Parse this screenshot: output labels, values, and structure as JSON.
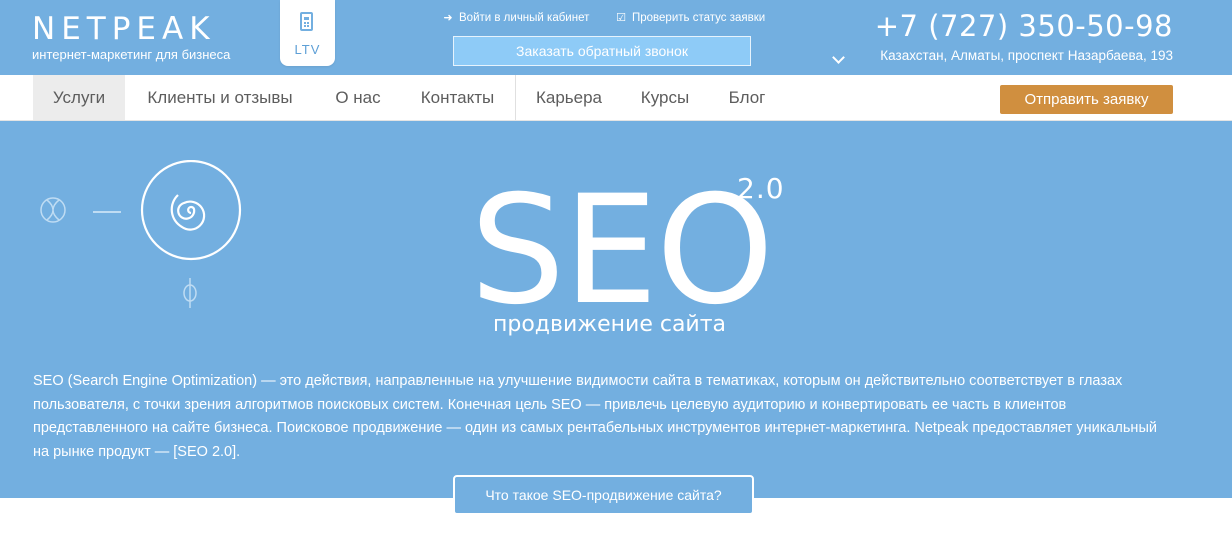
{
  "header": {
    "logo": "NETPEAK",
    "tagline": "интернет-маркетинг для бизнеса",
    "ltv_label": "LTV",
    "account_link": "Войти в личный кабинет",
    "status_link": "Проверить статус заявки",
    "callback_button": "Заказать обратный звонок",
    "phone": "+7 (727) 350-50-98",
    "address": "Казахстан, Алматы, проспект Назарбаева, 193",
    "icons": {
      "ltv": "calculator-icon",
      "account": "login-icon",
      "status": "checkbox-icon",
      "address": "chevron-down-icon"
    }
  },
  "nav": {
    "items": [
      {
        "label": "Услуги",
        "active": true
      },
      {
        "label": "Клиенты и отзывы"
      },
      {
        "label": "О нас"
      },
      {
        "label": "Контакты"
      },
      {
        "label": "Карьера"
      },
      {
        "label": "Курсы"
      },
      {
        "label": "Блог"
      }
    ],
    "cta_button": "Отправить заявку"
  },
  "hero": {
    "title": "SEO",
    "version": "2.0",
    "subtitle": "продвижение сайта",
    "description": "SEO (Search Engine Optimization) — это действия, направленные на улучшение видимости сайта в тематиках, которым он действительно соответствует в глазах пользователя, с точки зрения алгоритмов поисковых систем. Конечная цель SEO — привлечь целевую аудиторию и конвертировать ее часть в клиентов представленного на сайте бизнеса. Поисковое продвижение — один из самых рентабельных инструментов интернет-маркетинга. Netpeak предоставляет уникальный на рынке продукт — [SEO 2.0].",
    "more_button": "Что такое SEO-продвижение сайта?",
    "icons": [
      "dna-icon",
      "spiral-icon",
      "fork-icon"
    ]
  },
  "colors": {
    "brand_blue": "#73afe0",
    "callback_blue": "#8ecbf7",
    "cta_orange": "#d08f3f",
    "nav_text": "#5d5d5d"
  }
}
